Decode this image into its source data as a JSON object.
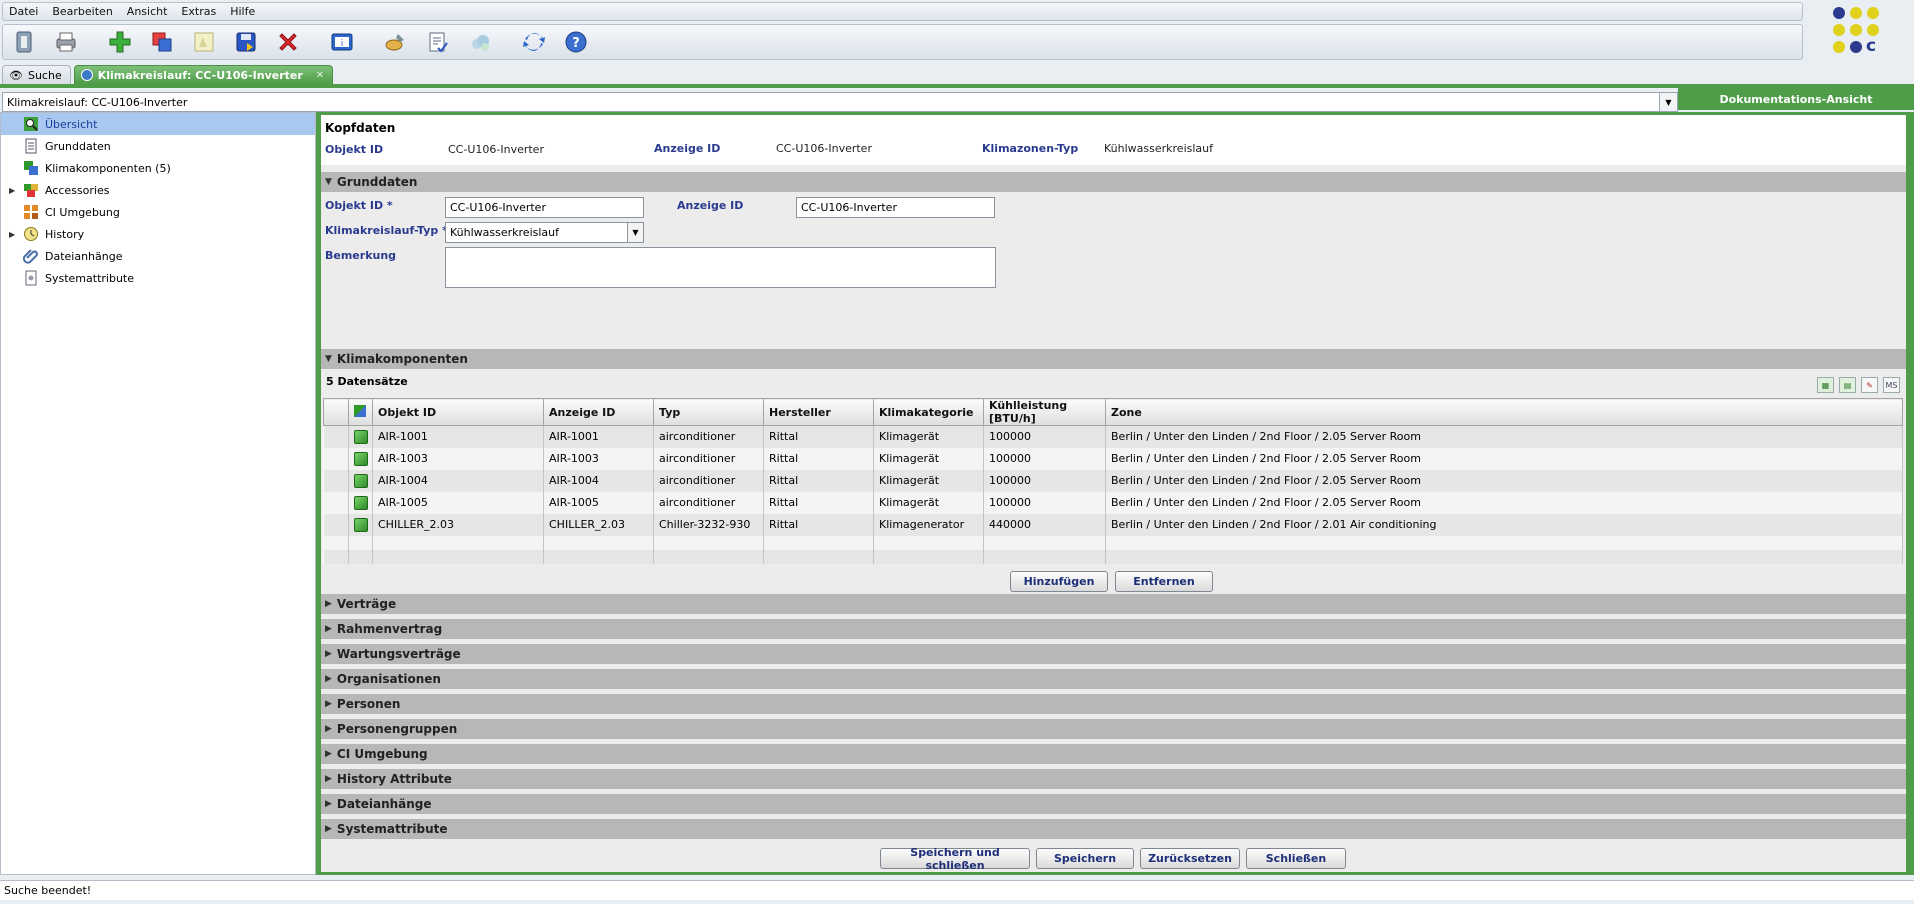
{
  "menu": [
    "Datei",
    "Bearbeiten",
    "Ansicht",
    "Extras",
    "Hilfe"
  ],
  "toolbar_icons": [
    "exit-icon",
    "print-icon",
    "new-icon",
    "duplicate-icon",
    "edit-icon",
    "save-icon",
    "delete-icon",
    "info-icon",
    "paint-icon",
    "report-icon",
    "cloud-icon",
    "refresh-icon",
    "help-icon"
  ],
  "tabs": [
    {
      "label": "Suche"
    },
    {
      "label": "Klimakreislauf: CC-U106-Inverter"
    }
  ],
  "selector": {
    "value": "Klimakreislauf: CC-U106-Inverter"
  },
  "doc_view": "Dokumentations-Ansicht",
  "tree": [
    {
      "label": "Übersicht"
    },
    {
      "label": "Grunddaten"
    },
    {
      "label": "Klimakomponenten (5)"
    },
    {
      "label": "Accessories"
    },
    {
      "label": "CI Umgebung"
    },
    {
      "label": "History"
    },
    {
      "label": "Dateianhänge"
    },
    {
      "label": "Systemattribute"
    }
  ],
  "kopf": {
    "title": "Kopfdaten",
    "objekt_id_label": "Objekt ID",
    "objekt_id_value": "CC-U106-Inverter",
    "anzeige_id_label": "Anzeige ID",
    "anzeige_id_value": "CC-U106-Inverter",
    "klimazonen_label": "Klimazonen-Typ",
    "klimazonen_value": "Kühlwasserkreislauf"
  },
  "grunddaten": {
    "title": "Grunddaten",
    "objekt_id_label": "Objekt ID *",
    "objekt_id_value": "CC-U106-Inverter",
    "anzeige_id_label": "Anzeige ID",
    "anzeige_id_value": "CC-U106-Inverter",
    "typ_label": "Klimakreislauf-Typ *",
    "typ_value": "Kühlwasserkreislauf",
    "bemerkung_label": "Bemerkung"
  },
  "komponenten": {
    "title": "Klimakomponenten",
    "count": "5 Datensätze",
    "export_icons": [
      "csv-export-icon",
      "excel-export-icon",
      "pdf-export-icon",
      "ms-export-icon"
    ],
    "export_ms": "MS",
    "columns": [
      "Objekt ID",
      "Anzeige ID",
      "Typ",
      "Hersteller",
      "Klimakategorie",
      "Kühlleistung [BTU/h]",
      "Zone"
    ],
    "rows": [
      [
        "AIR-1001",
        "AIR-1001",
        "airconditioner",
        "Rittal",
        "Klimagerät",
        "100000",
        "Berlin / Unter den Linden / 2nd Floor / 2.05 Server Room"
      ],
      [
        "AIR-1003",
        "AIR-1003",
        "airconditioner",
        "Rittal",
        "Klimagerät",
        "100000",
        "Berlin / Unter den Linden / 2nd Floor / 2.05 Server Room"
      ],
      [
        "AIR-1004",
        "AIR-1004",
        "airconditioner",
        "Rittal",
        "Klimagerät",
        "100000",
        "Berlin / Unter den Linden / 2nd Floor / 2.05 Server Room"
      ],
      [
        "AIR-1005",
        "AIR-1005",
        "airconditioner",
        "Rittal",
        "Klimagerät",
        "100000",
        "Berlin / Unter den Linden / 2nd Floor / 2.05 Server Room"
      ],
      [
        "CHILLER_2.03",
        "CHILLER_2.03",
        "Chiller-3232-930",
        "Rittal",
        "Klimagenerator",
        "440000",
        "Berlin / Unter den Linden / 2nd Floor / 2.01 Air conditioning"
      ]
    ],
    "add_label": "Hinzufügen",
    "remove_label": "Entfernen"
  },
  "sections": [
    "Verträge",
    "Rahmenvertrag",
    "Wartungsverträge",
    "Organisationen",
    "Personen",
    "Personengruppen",
    "CI Umgebung",
    "History Attribute",
    "Dateianhänge",
    "Systemattribute"
  ],
  "footer_buttons": {
    "save_close": "Speichern und schließen",
    "save": "Speichern",
    "reset": "Zurücksetzen",
    "close": "Schließen"
  },
  "status": "Suche beendet!"
}
